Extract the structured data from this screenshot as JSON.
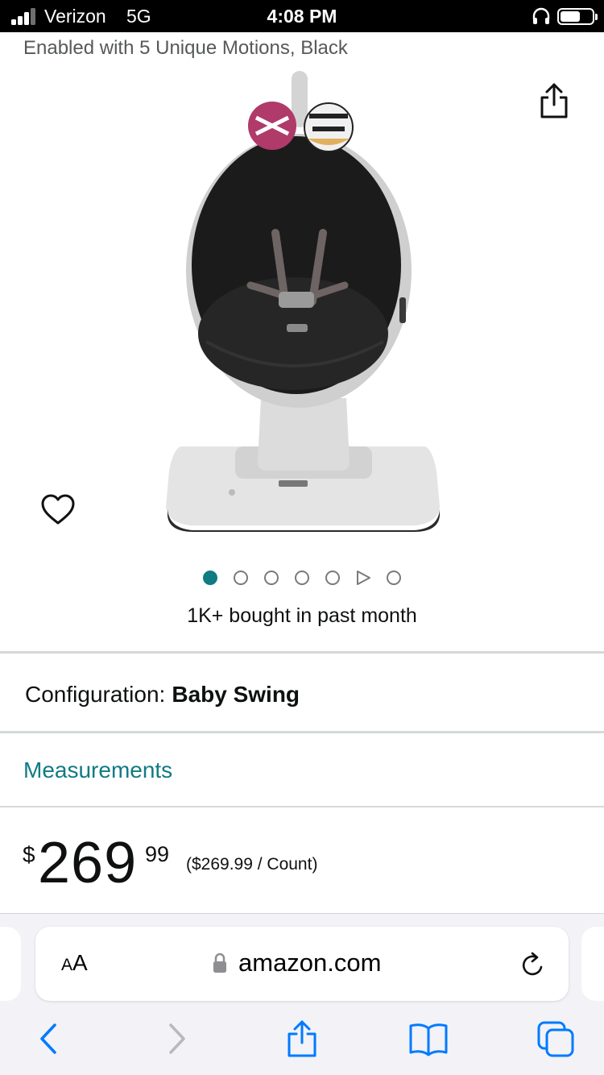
{
  "status_bar": {
    "carrier": "Verizon",
    "network": "5G",
    "time": "4:08 PM"
  },
  "product": {
    "title_fragment": "Enabled with 5 Unique Motions, Black",
    "image_dots_count": 7,
    "active_dot_index": 0,
    "bought_text": "1K+ bought in past month",
    "configuration_label": "Configuration:",
    "configuration_value": "Baby Swing",
    "measurements_link": "Measurements",
    "price": {
      "currency_symbol": "$",
      "whole": "269",
      "fraction": "99",
      "unit_price": "($269.99 / Count)"
    }
  },
  "browser": {
    "text_size_label_small": "A",
    "text_size_label_large": "A",
    "url": "amazon.com"
  },
  "icons": {
    "share": "share-icon",
    "wishlist": "heart-icon",
    "back": "chevron-left-icon",
    "forward": "chevron-right-icon",
    "bookmarks": "book-icon",
    "tabs": "tabs-icon"
  },
  "colors": {
    "accent": "#107b83",
    "ios_blue": "#007aff",
    "text": "#0f1111",
    "muted": "#565959"
  }
}
